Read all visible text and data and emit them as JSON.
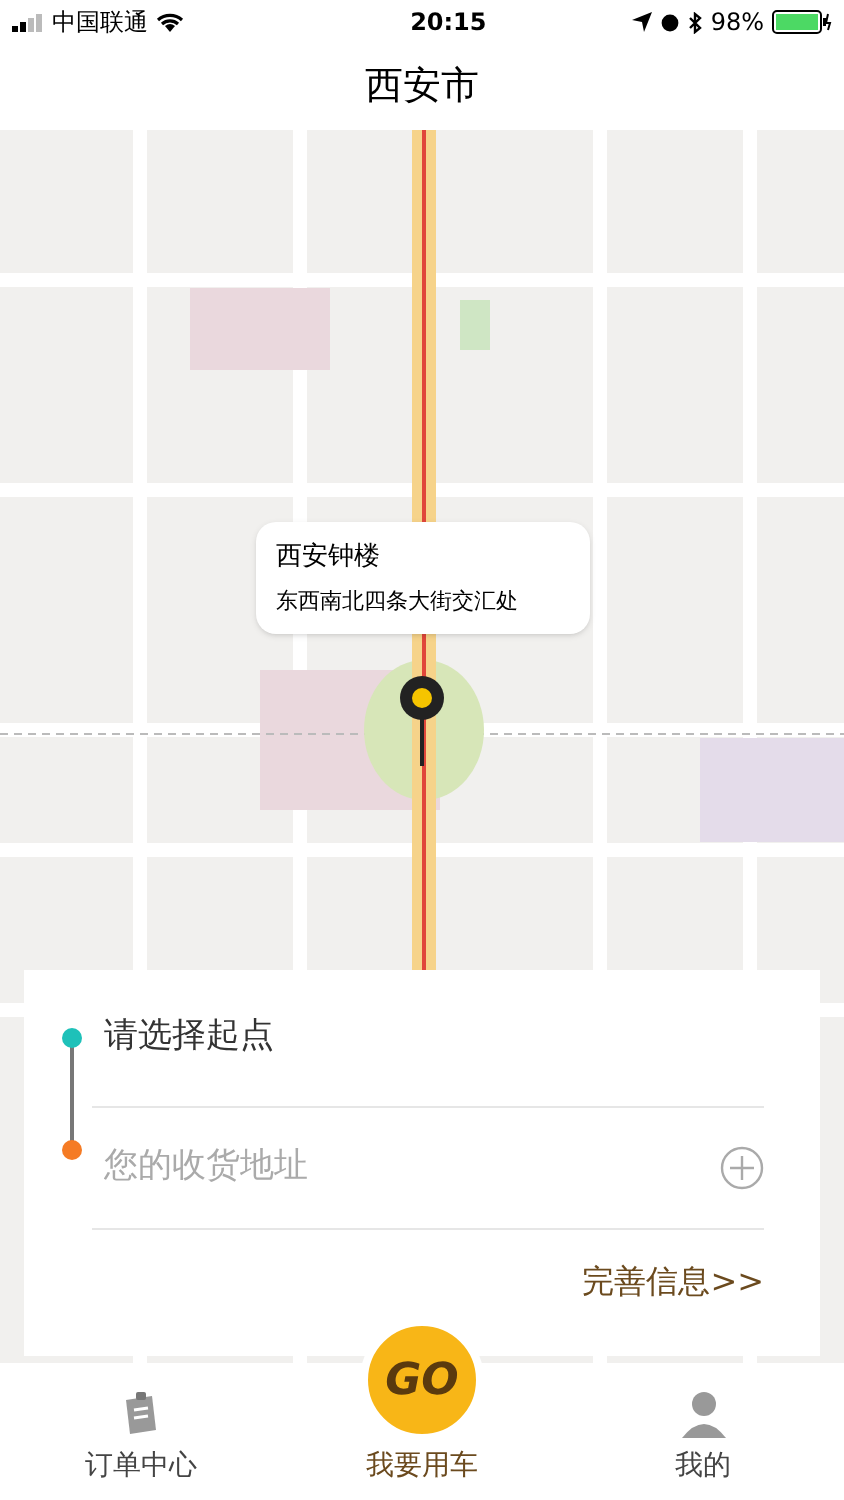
{
  "status_bar": {
    "carrier": "中国联通",
    "time": "20:15",
    "battery": "98%"
  },
  "nav": {
    "title": "西安市"
  },
  "map": {
    "callout": {
      "title": "西安钟楼",
      "subtitle": "东西南北四条大街交汇处"
    }
  },
  "route": {
    "start": {
      "placeholder": "请选择起点"
    },
    "destination": {
      "placeholder": "您的收货地址"
    },
    "more_link": "完善信息>>"
  },
  "tabs": [
    {
      "kind": "orders",
      "label": "订单中心",
      "selected": false
    },
    {
      "kind": "go",
      "badge": "GO",
      "label": "我要用车",
      "selected": true
    },
    {
      "kind": "profile",
      "label": "我的",
      "selected": false
    }
  ]
}
